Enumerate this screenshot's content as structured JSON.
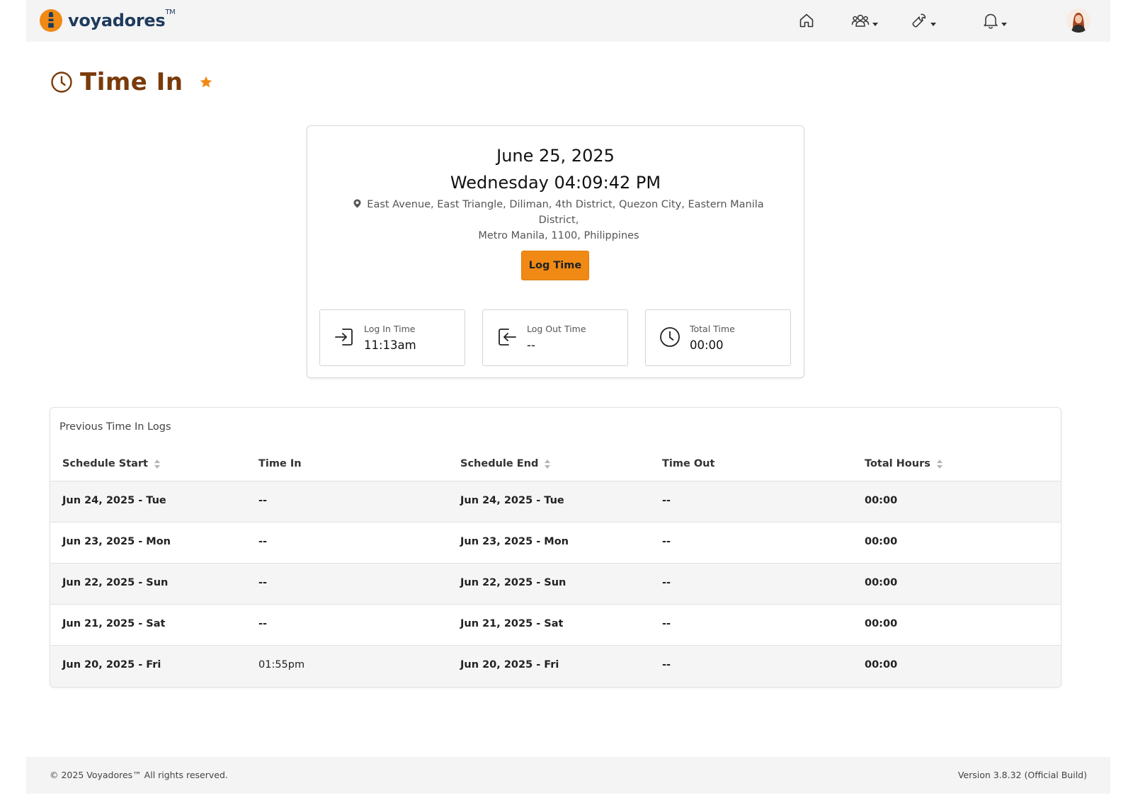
{
  "brand": {
    "name": "voyadores",
    "tm": "TM"
  },
  "nav": {
    "icons": [
      "home-icon",
      "users-icon",
      "wrench-icon",
      "bell-icon"
    ]
  },
  "page": {
    "title": "Time In"
  },
  "clock": {
    "date": "June 25, 2025",
    "day_time": "Wednesday 04:09:42 PM",
    "address_line1": "East Avenue, East Triangle, Diliman, 4th District, Quezon City, Eastern Manila District,",
    "address_line2": "Metro Manila, 1100, Philippines",
    "button": "Log Time"
  },
  "stats": {
    "login": {
      "label": "Log In Time",
      "value": "11:13am"
    },
    "logout": {
      "label": "Log Out Time",
      "value": "--"
    },
    "total": {
      "label": "Total Time",
      "value": "00:00"
    }
  },
  "logs": {
    "title": "Previous Time In Logs",
    "columns": {
      "schedule_start": "Schedule Start",
      "time_in": "Time In",
      "schedule_end": "Schedule End",
      "time_out": "Time Out",
      "total_hours": "Total Hours"
    },
    "rows": [
      {
        "schedule_start": "Jun 24, 2025 - Tue",
        "time_in": "--",
        "schedule_end": "Jun 24, 2025 - Tue",
        "time_out": "--",
        "total_hours": "00:00"
      },
      {
        "schedule_start": "Jun 23, 2025 - Mon",
        "time_in": "--",
        "schedule_end": "Jun 23, 2025 - Mon",
        "time_out": "--",
        "total_hours": "00:00"
      },
      {
        "schedule_start": "Jun 22, 2025 - Sun",
        "time_in": "--",
        "schedule_end": "Jun 22, 2025 - Sun",
        "time_out": "--",
        "total_hours": "00:00"
      },
      {
        "schedule_start": "Jun 21, 2025 - Sat",
        "time_in": "--",
        "schedule_end": "Jun 21, 2025 - Sat",
        "time_out": "--",
        "total_hours": "00:00"
      },
      {
        "schedule_start": "Jun 20, 2025 - Fri",
        "time_in": "01:55pm",
        "schedule_end": "Jun 20, 2025 - Fri",
        "time_out": "--",
        "total_hours": "00:00"
      }
    ]
  },
  "footer": {
    "copyright": "© 2025 Voyadores™ All rights reserved.",
    "version": "Version 3.8.32 (Official Build)"
  },
  "colors": {
    "accent": "#f08a14",
    "title": "#7a3b0a",
    "brand": "#1f3b5c"
  }
}
